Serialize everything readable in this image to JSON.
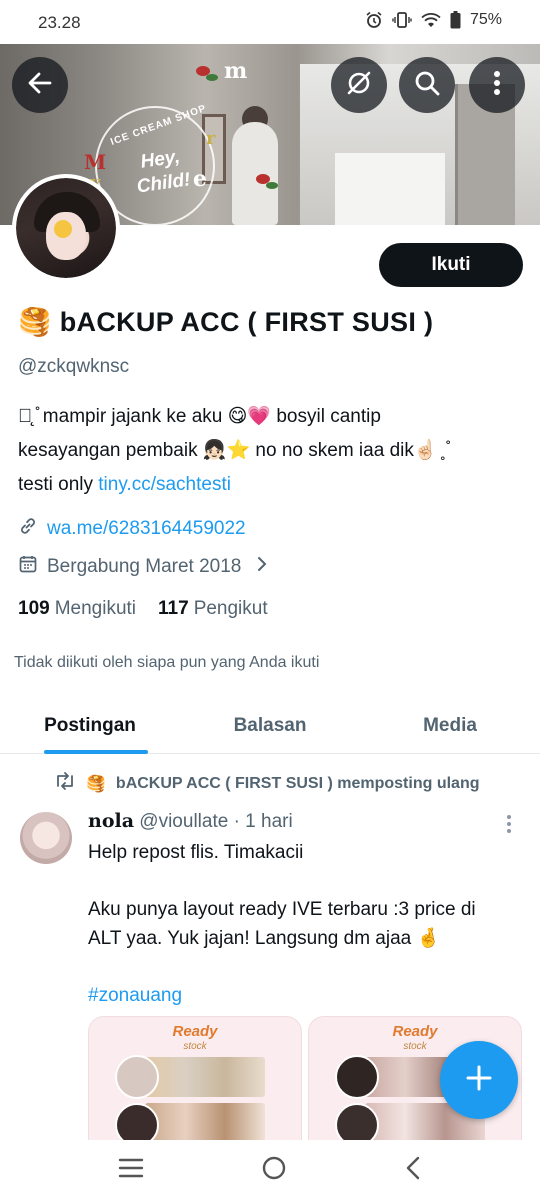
{
  "status_bar": {
    "time": "23.28",
    "battery": "75%",
    "icons": [
      "alarm-icon",
      "vibrate-icon",
      "wifi-icon",
      "battery-icon"
    ]
  },
  "header": {
    "back_icon": "back-arrow-icon",
    "buttons": [
      "grok-icon",
      "search-icon",
      "more-vertical-icon"
    ],
    "banner_sticker": {
      "label": "ICE CREAM SHOP",
      "title": "Hey, Child!"
    }
  },
  "profile": {
    "follow_label": "Ikuti",
    "name_emoji": "🥞",
    "display_name": "bACKUP ACC ( FIRST SUSI )",
    "handle": "@zckqwknsc",
    "bio": {
      "line1": "︶̨ ̊ mampir jajank ke aku 😋💗 bosyil cantip",
      "line2": "kesayangan pembaik 👧🏻⭐ no no skem iaa dik☝🏻 ̥ ̊",
      "line3_prefix": "testi only ",
      "line3_link": "tiny.cc/sachtesti"
    },
    "website": "wa.me/6283164459022",
    "joined": "Bergabung Maret 2018",
    "following_count": "109",
    "following_label": "Mengikuti",
    "followers_count": "117",
    "followers_label": "Pengikut",
    "not_followed_text": "Tidak diikuti oleh siapa pun yang Anda ikuti"
  },
  "tabs": [
    {
      "label": "Postingan",
      "active": true
    },
    {
      "label": "Balasan",
      "active": false
    },
    {
      "label": "Media",
      "active": false
    }
  ],
  "post": {
    "repost_emoji": "🥞",
    "repost_text": "bACKUP ACC ( FIRST SUSI ) memposting ulang",
    "author_name": "nola",
    "author_handle": "@vioullate",
    "time": "· 1 hari",
    "line1": "Help repost flis. Timakacii",
    "line2": "Aku punya layout ready IVE terbaru :3 price di",
    "line3": "ALT yaa. Yuk jajan! Langsung dm ajaa 🤞",
    "hashtag": "#zonauang",
    "media": [
      {
        "title": "Ready",
        "subtitle": "stock"
      },
      {
        "title": "Ready",
        "subtitle": "stock"
      }
    ]
  },
  "fab": {
    "icon": "compose-plus-icon"
  },
  "nav_bar": {
    "icons": [
      "recents-icon",
      "home-icon",
      "back-icon"
    ]
  },
  "colors": {
    "accent": "#1d9bf0",
    "text": "#0f1419",
    "secondary": "#536471"
  }
}
